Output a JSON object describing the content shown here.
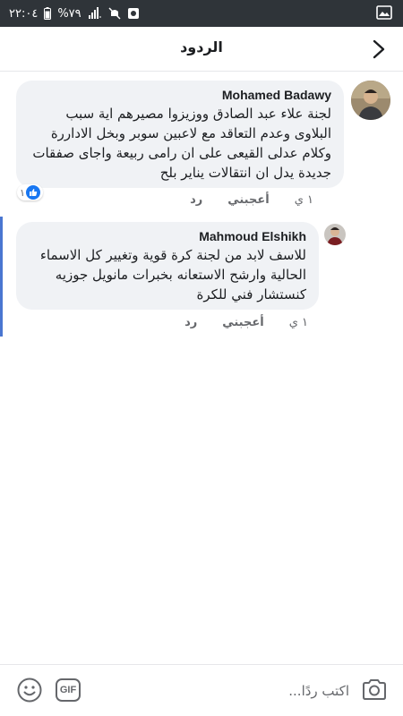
{
  "status_bar": {
    "time": "٢٢:٠٤",
    "battery": "%٧٩"
  },
  "header": {
    "title": "الردود"
  },
  "comments": [
    {
      "author": "Mohamed Badawy",
      "text": "لجنة علاء عبد الصادق ووزيزوا مصيرهم اية سبب البلاوى وعدم التعاقد مع لاعبين سوبر وبخل الاداررة وكلام عدلى القيعى على ان رامى ربيعة واجاى صفقات جديدة يدل ان انتقالات يناير بلح",
      "time": "١ ي",
      "like_label": "أعجبني",
      "reply_label": "رد",
      "reaction_count": "١"
    },
    {
      "author": "Mahmoud Elshikh",
      "text": "للاسف لابد من لجنة كرة قوية وتغيير كل الاسماء الحالية وارشح الاستعانه بخبرات مانويل جوزيه كنستشار فني للكرة",
      "time": "١ ي",
      "like_label": "أعجبني",
      "reply_label": "رد"
    }
  ],
  "composer": {
    "placeholder": "اكتب ردًا...",
    "gif_label": "GIF"
  },
  "colors": {
    "accent": "#1877f2",
    "bubble": "#f0f2f5",
    "status_bar": "#2f3439"
  }
}
